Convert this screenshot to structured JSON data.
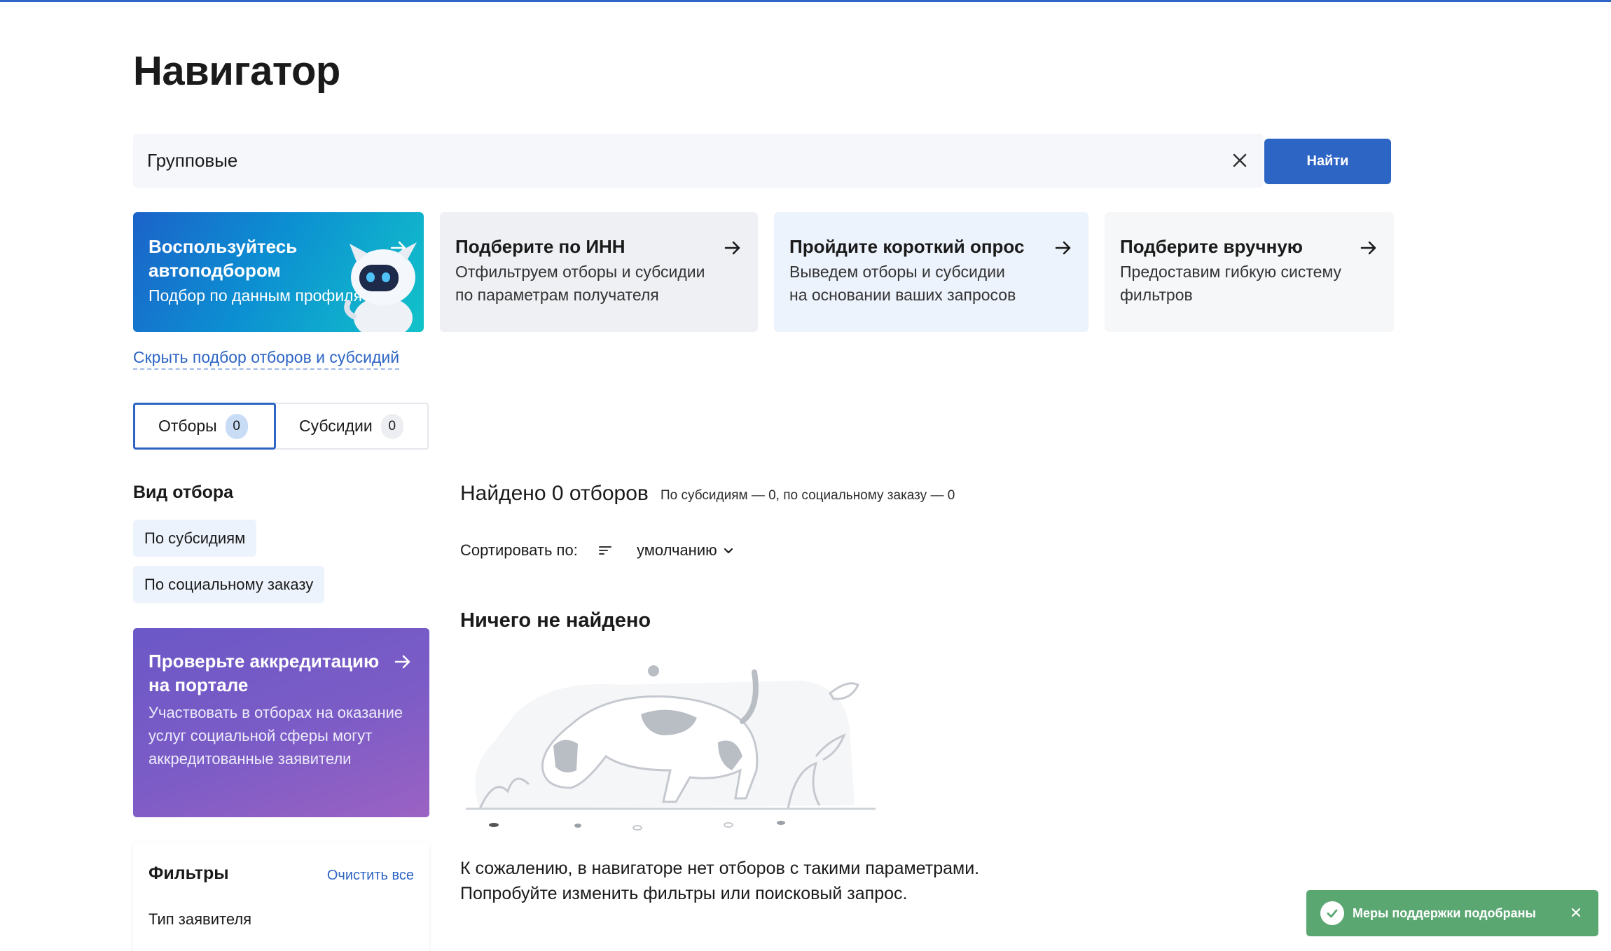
{
  "page": {
    "title": "Навигатор"
  },
  "search": {
    "value": "Групповые",
    "clear_icon": "close-icon",
    "button_label": "Найти"
  },
  "cards": {
    "auto": {
      "title": "Воспользуйтесь автоподбором",
      "text": "Подбор по данным профиля",
      "icon": "arrow-right-icon"
    },
    "inn": {
      "title": "Подберите по ИНН",
      "text_line1": "Отфильтруем отборы и субсидии",
      "text_line2": "по параметрам получателя"
    },
    "poll": {
      "title": "Пройдите короткий опрос",
      "text_line1": "Выведем отборы и субсидии",
      "text_line2": "на основании ваших запросов"
    },
    "manual": {
      "title": "Подберите вручную",
      "text_line1": "Предоставим гибкую систему",
      "text_line2": "фильтров"
    }
  },
  "hide_link": "Скрыть подбор отборов и субсидий",
  "tabs": [
    {
      "label": "Отборы",
      "count": "0"
    },
    {
      "label": "Субсидии",
      "count": "0"
    }
  ],
  "sidebar": {
    "heading": "Вид отбора",
    "chips": [
      "По субсидиям",
      "По социальному заказу"
    ],
    "accreditation": {
      "title": "Проверьте аккредитацию на портале",
      "text": "Участвовать в отборах на оказание услуг социальной сферы могут аккредитованные заявители"
    },
    "filters": {
      "title": "Фильтры",
      "clear": "Очистить все",
      "applicant_type": "Тип заявителя"
    }
  },
  "results": {
    "found": "Найдено 0 отборов",
    "found_sub": "По субсидиям — 0, по социальному заказу — 0",
    "sort_label": "Сортировать по:",
    "sort_value": "умолчанию",
    "empty_title": "Ничего не найдено",
    "empty_line1": "К сожалению, в навигаторе нет отборов с такими параметрами.",
    "empty_line2": "Попробуйте изменить фильтры или поисковый запрос."
  },
  "toast": {
    "text": "Меры поддержки подобраны"
  },
  "colors": {
    "accent": "#2d65c4",
    "toast": "#5ba772",
    "accreditation": "#7c5cc6"
  }
}
